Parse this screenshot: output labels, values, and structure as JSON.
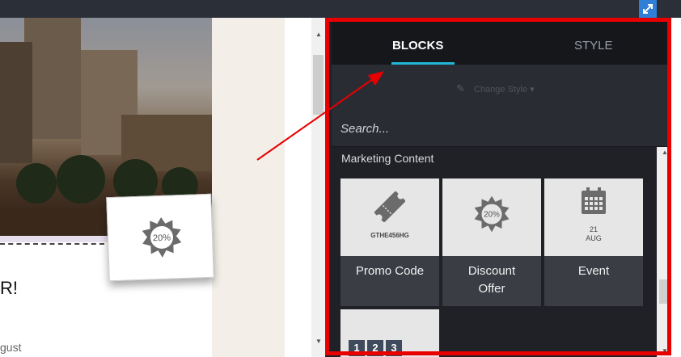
{
  "preview": {
    "headline": "R!",
    "subtext": "gust",
    "coupon_text": "20%"
  },
  "panel": {
    "tabs": [
      {
        "label": "BLOCKS",
        "active": true
      },
      {
        "label": "STYLE",
        "active": false
      }
    ],
    "change_style_label": "Change Style ▾",
    "search_placeholder": "Search...",
    "section_title": "Marketing Content",
    "blocks": [
      {
        "label": "Promo Code",
        "icon": "ticket-icon",
        "caption": "GTHE456HG"
      },
      {
        "label": "Discount Offer",
        "icon": "discount-badge-icon",
        "caption": "20%"
      },
      {
        "label": "Event",
        "icon": "calendar-icon",
        "caption_day": "21",
        "caption_month": "AUG"
      },
      {
        "label": "",
        "icon": "steps-icon",
        "digits": [
          "1",
          "2",
          "3"
        ]
      }
    ]
  },
  "colors": {
    "annotation_red": "#e80000",
    "tab_accent": "#1fb6d8",
    "panel_bg": "#1f2126"
  }
}
